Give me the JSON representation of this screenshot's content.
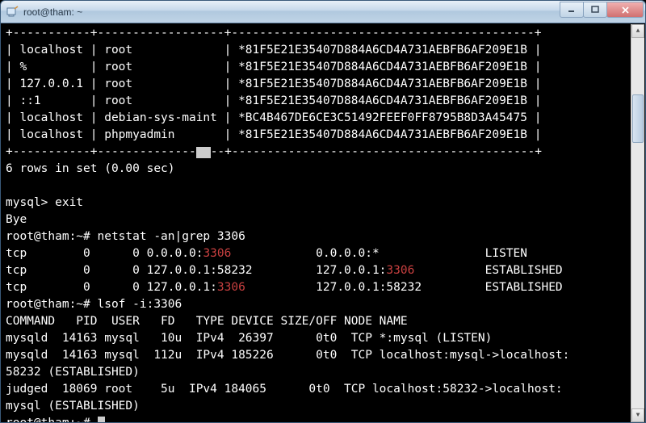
{
  "window": {
    "title": "root@tham: ~"
  },
  "mysql_table": {
    "rowsep": "+-----------+------------------+-------------------------------------------+",
    "rows": [
      {
        "host": "localhost",
        "user": "root",
        "pw": "*81F5E21E35407D884A6CD4A731AEBFB6AF209E1B"
      },
      {
        "host": "%",
        "user": "root",
        "pw": "*81F5E21E35407D884A6CD4A731AEBFB6AF209E1B"
      },
      {
        "host": "127.0.0.1",
        "user": "root",
        "pw": "*81F5E21E35407D884A6CD4A731AEBFB6AF209E1B"
      },
      {
        "host": "::1",
        "user": "root",
        "pw": "*81F5E21E35407D884A6CD4A731AEBFB6AF209E1B"
      },
      {
        "host": "localhost",
        "user": "debian-sys-maint",
        "pw": "*BC4B467DE6CE3C51492FEEF0FF8795B8D3A45475"
      },
      {
        "host": "localhost",
        "user": "phpmyadmin",
        "pw": "*81F5E21E35407D884A6CD4A731AEBFB6AF209E1B"
      }
    ],
    "rowsep2a": "+-----------+--------------",
    "rowsep2b": "--+-------------------------------------------+",
    "summary": "6 rows in set (0.00 sec)"
  },
  "session": {
    "prompt_mysql": "mysql> ",
    "cmd_exit": "exit",
    "bye": "Bye",
    "prompt_shell": "root@tham:~# ",
    "cmd_netstat": "netstat -an|grep 3306",
    "cmd_lsof": "lsof -i:3306"
  },
  "netstat": {
    "rows": [
      {
        "proto": "tcp",
        "recvq": "0",
        "sendq": "0",
        "local_pre": "0.0.0.0:",
        "local_hl": "3306",
        "local_post": "",
        "foreign_pre": "0.0.0.0:*",
        "foreign_hl": "",
        "foreign_post": "",
        "state": "LISTEN"
      },
      {
        "proto": "tcp",
        "recvq": "0",
        "sendq": "0",
        "local_pre": "127.0.0.1:58232",
        "local_hl": "",
        "local_post": "",
        "foreign_pre": "127.0.0.1:",
        "foreign_hl": "3306",
        "foreign_post": "",
        "state": "ESTABLISHED"
      },
      {
        "proto": "tcp",
        "recvq": "0",
        "sendq": "0",
        "local_pre": "127.0.0.1:",
        "local_hl": "3306",
        "local_post": "",
        "foreign_pre": "127.0.0.1:58232",
        "foreign_hl": "",
        "foreign_post": "",
        "state": "ESTABLISHED"
      }
    ]
  },
  "lsof": {
    "header": "COMMAND   PID  USER   FD   TYPE DEVICE SIZE/OFF NODE NAME",
    "rows": [
      {
        "line": "mysqld  14163 mysql   10u  IPv4  26397      0t0  TCP *:mysql (LISTEN)"
      },
      {
        "line": "mysqld  14163 mysql  112u  IPv4 185226      0t0  TCP localhost:mysql->localhost:",
        "cont": "58232 (ESTABLISHED)"
      },
      {
        "line": "judged  18069 root    5u  IPv4 184065      0t0  TCP localhost:58232->localhost:",
        "cont": "mysql (ESTABLISHED)"
      }
    ]
  }
}
